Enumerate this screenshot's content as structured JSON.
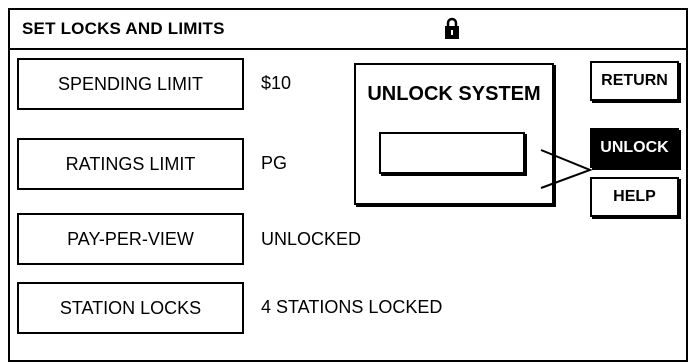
{
  "header": {
    "title": "SET LOCKS AND LIMITS",
    "icon": "padlock-icon"
  },
  "menu": [
    {
      "label": "SPENDING LIMIT",
      "value": "$10"
    },
    {
      "label": "RATINGS LIMIT",
      "value": "PG"
    },
    {
      "label": "PAY-PER-VIEW",
      "value": "UNLOCKED"
    },
    {
      "label": "STATION LOCKS",
      "value": "4 STATIONS LOCKED"
    }
  ],
  "unlock_panel": {
    "title": "UNLOCK SYSTEM",
    "input_value": ""
  },
  "side_buttons": {
    "return_label": "RETURN",
    "unlock_label": "UNLOCK",
    "help_label": "HELP"
  },
  "colors": {
    "active_button_bg": "#000000",
    "active_button_fg": "#ffffff"
  }
}
